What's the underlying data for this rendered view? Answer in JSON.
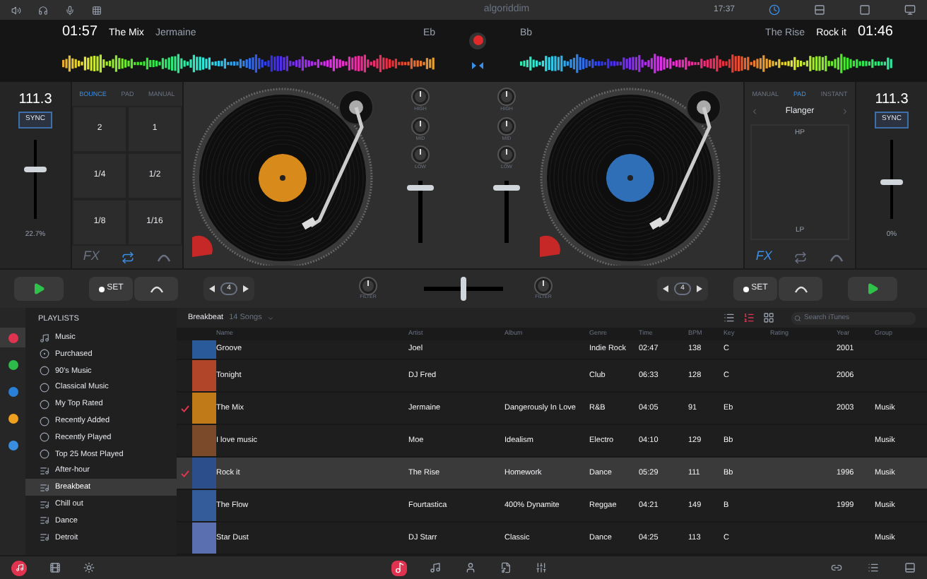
{
  "top_bar": {
    "logo": "algoriddim",
    "time": "17:37"
  },
  "decks": [
    {
      "time": "01:57",
      "title": "The Mix",
      "artist": "Jermaine",
      "key": "Eb",
      "bpm": "111.3",
      "sync": "SYNC",
      "pitch_reading": "22.7%",
      "pitch": {
        "level": 0.62
      },
      "volume": {
        "level": 0.92
      },
      "eq": [
        "HIGH",
        "MID",
        "LOW"
      ],
      "filter_label": "FILTER",
      "loop_count": "4",
      "set_label": "SET",
      "playing": false
    },
    {
      "time": "01:46",
      "title": "Rock it",
      "artist": "The Rise",
      "key": "Bb",
      "bpm": "111.3",
      "sync": "SYNC",
      "pitch_reading": "0%",
      "pitch": {
        "level": 0.45
      },
      "volume": {
        "level": 0.92
      },
      "eq": [
        "HIGH",
        "MID",
        "LOW"
      ],
      "filter_label": "FILTER",
      "loop_count": "4",
      "set_label": "SET",
      "playing": false
    }
  ],
  "pad_panel": {
    "tabs": [
      {
        "label": "BOUNCE",
        "selected": true
      },
      {
        "label": "PAD",
        "selected": false
      },
      {
        "label": "MANUAL",
        "selected": false
      }
    ],
    "pads": [
      "2",
      "1",
      "1/4",
      "1/2",
      "1/8",
      "1/16"
    ],
    "fx_label": "FX",
    "modes": [
      {
        "kind": "fx",
        "selected": false
      },
      {
        "kind": "loop",
        "selected": true
      },
      {
        "kind": "curve",
        "selected": false
      }
    ]
  },
  "fx_panel": {
    "tabs": [
      {
        "label": "MANUAL",
        "selected": false
      },
      {
        "label": "PAD",
        "selected": true
      },
      {
        "label": "INSTANT",
        "selected": false
      }
    ],
    "effect": "Flanger",
    "top_label": "HP",
    "bottom_label": "LP",
    "fx_label": "FX",
    "modes": [
      {
        "kind": "fx",
        "selected": true
      },
      {
        "kind": "loop",
        "selected": false
      },
      {
        "kind": "curve",
        "selected": false
      }
    ]
  },
  "crossfader": {
    "level": 0.5
  },
  "sources": [
    {
      "color": "#e0334f",
      "selected": true
    },
    {
      "color": "#2dbb4a",
      "selected": false
    },
    {
      "color": "#2a7fd8",
      "selected": false
    },
    {
      "color": "#f0a020",
      "selected": false
    },
    {
      "color": "#3a8ee0",
      "selected": false
    }
  ],
  "playlists_title": "PLAYLISTS",
  "playlists": [
    {
      "label": "Music",
      "kind": "library",
      "selected": false
    },
    {
      "label": "Purchased",
      "kind": "purchased",
      "selected": false
    },
    {
      "label": "90's Music",
      "kind": "smart",
      "selected": false
    },
    {
      "label": "Classical Music",
      "kind": "smart",
      "selected": false
    },
    {
      "label": "My Top Rated",
      "kind": "smart",
      "selected": false
    },
    {
      "label": "Recently Added",
      "kind": "smart",
      "selected": false
    },
    {
      "label": "Recently Played",
      "kind": "smart",
      "selected": false
    },
    {
      "label": "Top 25 Most Played",
      "kind": "smart",
      "selected": false
    },
    {
      "label": "After-hour",
      "kind": "playlist",
      "selected": false
    },
    {
      "label": "Breakbeat",
      "kind": "playlist",
      "selected": true
    },
    {
      "label": "Chill out",
      "kind": "playlist",
      "selected": false
    },
    {
      "label": "Dance",
      "kind": "playlist",
      "selected": false
    },
    {
      "label": "Detroit",
      "kind": "playlist",
      "selected": false
    }
  ],
  "library": {
    "title": "Breakbeat",
    "count": "14 Songs",
    "views": [
      {
        "kind": "list",
        "selected": false
      },
      {
        "kind": "detail",
        "selected": true
      },
      {
        "kind": "grid",
        "selected": false
      }
    ],
    "search": {
      "placeholder": "Search iTunes"
    },
    "columns": [
      "Name",
      "Artist",
      "Album",
      "Genre",
      "Time",
      "BPM",
      "Key",
      "Rating",
      "Year",
      "Group"
    ],
    "rows": [
      {
        "name": "Groove",
        "artist": "Joel",
        "genre": "Indie Rock",
        "time": "02:47",
        "bpm": "138",
        "key": "C",
        "year": "2001",
        "loaded": false,
        "selected": false
      },
      {
        "name": "Tonight",
        "artist": "DJ Fred",
        "genre": "Club",
        "time": "06:33",
        "bpm": "128",
        "key": "C",
        "year": "2006",
        "loaded": false,
        "selected": false
      },
      {
        "name": "The Mix",
        "artist": "Jermaine",
        "album": "Dangerously In Love",
        "genre": "R&B",
        "time": "04:05",
        "bpm": "91",
        "key": "Eb",
        "year": "2003",
        "group": "Musik",
        "loaded": true,
        "selected": false
      },
      {
        "name": "I love music",
        "artist": "Moe",
        "album": "Idealism",
        "genre": "Electro",
        "time": "04:10",
        "bpm": "129",
        "key": "Bb",
        "group": "Musik",
        "loaded": false,
        "selected": false
      },
      {
        "name": "Rock it",
        "artist": "The Rise",
        "album": "Homework",
        "genre": "Dance",
        "time": "05:29",
        "bpm": "111",
        "key": "Bb",
        "year": "1996",
        "group": "Musik",
        "loaded": true,
        "selected": true
      },
      {
        "name": "The Flow",
        "artist": "Fourtastica",
        "album": "400% Dynamite",
        "genre": "Reggae",
        "time": "04:21",
        "bpm": "149",
        "key": "B",
        "year": "1999",
        "group": "Musik",
        "loaded": false,
        "selected": false
      },
      {
        "name": "Star Dust",
        "artist": "DJ Starr",
        "album": "Classic",
        "genre": "Dance",
        "time": "04:25",
        "bpm": "113",
        "key": "C",
        "group": "Musik",
        "loaded": false,
        "selected": false
      }
    ]
  },
  "bottom_tabs": [
    {
      "kind": "songs",
      "selected": true
    },
    {
      "kind": "music",
      "selected": false
    },
    {
      "kind": "artist",
      "selected": false
    },
    {
      "kind": "album",
      "selected": false
    },
    {
      "kind": "mixer",
      "selected": false
    }
  ]
}
